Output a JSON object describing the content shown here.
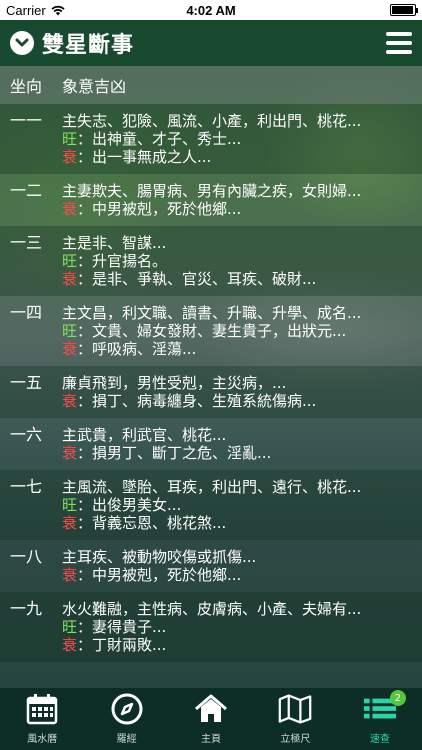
{
  "status": {
    "carrier": "Carrier",
    "time": "4:02 AM",
    "battery_level": 0.95
  },
  "header": {
    "title": "雙星斷事",
    "title_icon": "chevron-down-circle-icon",
    "menu_icon": "hamburger-menu-icon"
  },
  "columns": {
    "direction": "坐向",
    "meaning": "象意吉凶"
  },
  "rows": [
    {
      "dir": "一一",
      "main": "主失志、犯險、風流、小產，利出門、桃花...",
      "wang_tag": "旺",
      "wang": "：出神童、才子、秀士...",
      "shuai_tag": "衰",
      "shuai": "：出一事無成之人..."
    },
    {
      "dir": "一二",
      "main": "主妻欺夫、腸胃病、男有內臟之疾，女則婦...",
      "shuai_tag": "衰",
      "shuai": "：中男被剋，死於他鄉..."
    },
    {
      "dir": "一三",
      "main": "主是非、智謀...",
      "wang_tag": "旺",
      "wang": "：升官揚名。",
      "shuai_tag": "衰",
      "shuai": "：是非、爭執、官災、耳疾、破財..."
    },
    {
      "dir": "一四",
      "main": "主文昌，利文職、讀書、升職、升學、成名...",
      "wang_tag": "旺",
      "wang": "：文貴、婦女發財、妻生貴子，出狀元...",
      "shuai_tag": "衰",
      "shuai": "：呼吸病、淫蕩..."
    },
    {
      "dir": "一五",
      "main": "廉貞飛到，男性受剋，主災病，...",
      "shuai_tag": "衰",
      "shuai": "：損丁、病毒纏身、生殖系統傷病..."
    },
    {
      "dir": "一六",
      "main": "主武貴，利武官、桃花...",
      "shuai_tag": "衰",
      "shuai": "：損男丁、斷丁之危、淫亂..."
    },
    {
      "dir": "一七",
      "main": "主風流、墜胎、耳疾，利出門、遠行、桃花...",
      "wang_tag": "旺",
      "wang": "：出俊男美女...",
      "shuai_tag": "衰",
      "shuai": "：背義忘恩、桃花煞..."
    },
    {
      "dir": "一八",
      "main": "主耳疾、被動物咬傷或抓傷...",
      "shuai_tag": "衰",
      "shuai": "：中男被剋，死於他鄉..."
    },
    {
      "dir": "一九",
      "main": "水火難融，主性病、皮膚病、小產、夫婦有...",
      "wang_tag": "旺",
      "wang": "：妻得貴子...",
      "shuai_tag": "衰",
      "shuai": "：丁財兩敗..."
    }
  ],
  "tabs": [
    {
      "label": "風水曆",
      "icon": "calendar-icon"
    },
    {
      "label": "羅經",
      "icon": "compass-icon"
    },
    {
      "label": "主頁",
      "icon": "home-icon"
    },
    {
      "label": "立極尺",
      "icon": "map-icon"
    },
    {
      "label": "速查",
      "icon": "list-icon",
      "badge": "2",
      "active": true
    }
  ],
  "colors": {
    "wang": "#7fe35a",
    "shuai": "#ff4a4a",
    "active_tab": "#29d4a6",
    "badge": "#52c93a"
  }
}
